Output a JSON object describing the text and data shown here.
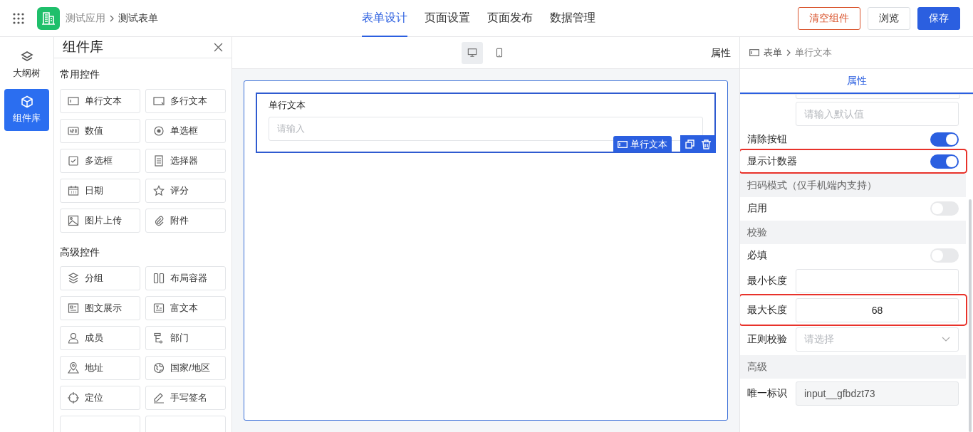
{
  "header": {
    "breadcrumb": [
      "测试应用",
      "测试表单"
    ],
    "tabs": [
      {
        "label": "表单设计",
        "selected": true
      },
      {
        "label": "页面设置",
        "selected": false
      },
      {
        "label": "页面发布",
        "selected": false
      },
      {
        "label": "数据管理",
        "selected": false
      }
    ],
    "buttons": [
      {
        "label": "清空组件",
        "kind": "danger"
      },
      {
        "label": "浏览",
        "kind": "default"
      },
      {
        "label": "保存",
        "kind": "primary"
      }
    ]
  },
  "rail": [
    {
      "label": "大纲树",
      "selected": false
    },
    {
      "label": "组件库",
      "selected": true
    }
  ],
  "library": {
    "title": "组件库",
    "groups": [
      {
        "title": "常用控件",
        "items": [
          "单行文本",
          "多行文本",
          "数值",
          "单选框",
          "多选框",
          "选择器",
          "日期",
          "评分",
          "图片上传",
          "附件"
        ]
      },
      {
        "title": "高级控件",
        "items": [
          "分组",
          "布局容器",
          "图文展示",
          "富文本",
          "成员",
          "部门",
          "地址",
          "国家/地区",
          "定位",
          "手写签名"
        ]
      }
    ]
  },
  "canvas": {
    "devices": [
      {
        "kind": "desktop",
        "selected": true
      },
      {
        "kind": "mobile",
        "selected": false
      }
    ],
    "panel_label": "属性",
    "field": {
      "label": "单行文本",
      "placeholder": "请输入",
      "tag": "单行文本"
    }
  },
  "properties": {
    "breadcrumb": [
      "表单",
      "单行文本"
    ],
    "tabs": [
      {
        "label": "属性",
        "selected": true
      }
    ],
    "rows": [
      {
        "kind": "input",
        "label": "",
        "placeholder": "请输入默认值",
        "highlighted": false
      },
      {
        "kind": "toggle",
        "label": "清除按钮",
        "on": true,
        "highlighted": false
      },
      {
        "kind": "toggle",
        "label": "显示计数器",
        "on": true,
        "highlighted": true
      },
      {
        "kind": "section",
        "label": "扫码模式（仅手机端内支持）"
      },
      {
        "kind": "toggle",
        "label": "启用",
        "on": false,
        "highlighted": false
      },
      {
        "kind": "section",
        "label": "校验"
      },
      {
        "kind": "toggle",
        "label": "必填",
        "on": false,
        "highlighted": false
      },
      {
        "kind": "input",
        "label": "最小长度",
        "value": "",
        "highlighted": false
      },
      {
        "kind": "input",
        "label": "最大长度",
        "value": "68",
        "highlighted": true
      },
      {
        "kind": "select",
        "label": "正则校验",
        "placeholder": "请选择",
        "highlighted": false
      },
      {
        "kind": "section",
        "label": "高级"
      },
      {
        "kind": "readonly",
        "label": "唯一标识",
        "value": "input__gfbdzt73",
        "highlighted": false
      }
    ]
  }
}
